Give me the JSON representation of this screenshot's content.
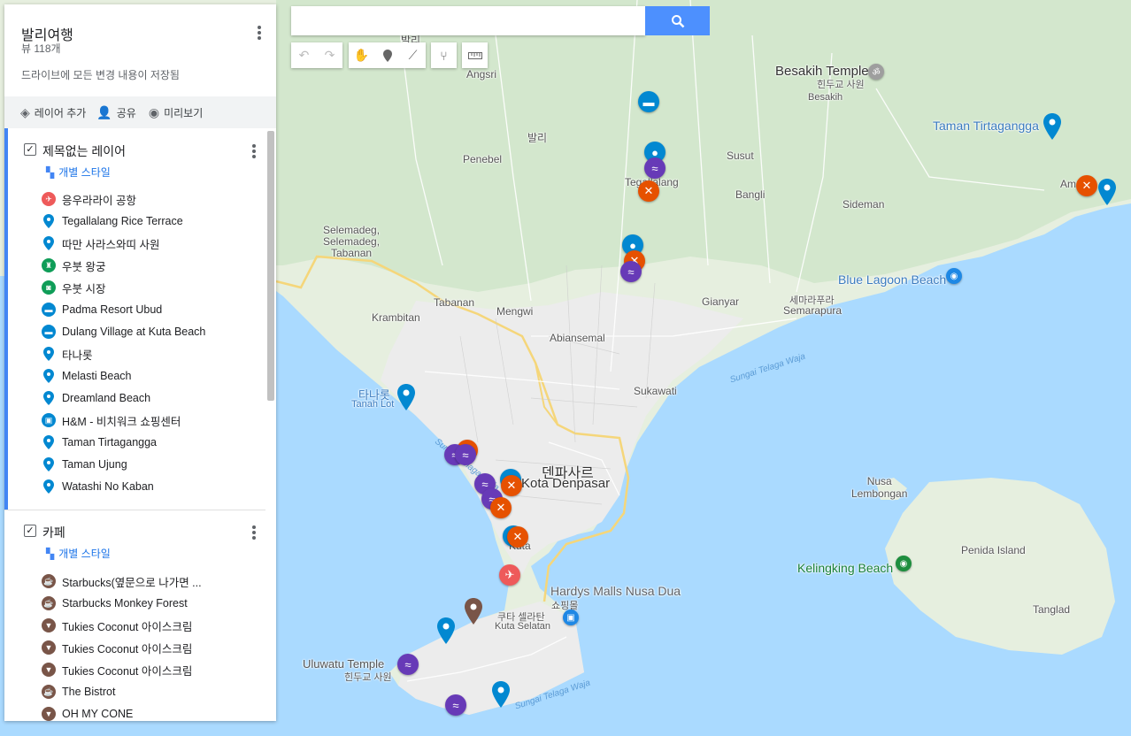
{
  "panel": {
    "title": "발리여행",
    "views": "뷰 118개",
    "saved_status": "드라이브에 모든 변경 내용이 저장됨",
    "actions": {
      "add_layer": "레이어 추가",
      "share": "공유",
      "preview": "미리보기"
    },
    "layers": [
      {
        "name": "제목없는 레이어",
        "style_link": "개별 스타일",
        "checked": true,
        "items": [
          {
            "label": "응우라라이 공항",
            "icon": "airport-icon",
            "color": "#ee5a5a"
          },
          {
            "label": "Tegallalang Rice Terrace",
            "icon": "pin-icon",
            "color": "#0288d1"
          },
          {
            "label": "따만 사라스와띠 사원",
            "icon": "pin-icon",
            "color": "#0288d1"
          },
          {
            "label": "우붓 왕궁",
            "icon": "castle-icon",
            "color": "#0f9d58"
          },
          {
            "label": "우붓 시장",
            "icon": "market-icon",
            "color": "#0f9d58"
          },
          {
            "label": "Padma Resort Ubud",
            "icon": "hotel-icon",
            "color": "#0288d1"
          },
          {
            "label": "Dulang Village at Kuta Beach",
            "icon": "hotel-icon",
            "color": "#0288d1"
          },
          {
            "label": "타나롯",
            "icon": "pin-icon",
            "color": "#0288d1"
          },
          {
            "label": "Melasti Beach",
            "icon": "pin-icon",
            "color": "#0288d1"
          },
          {
            "label": "Dreamland Beach",
            "icon": "pin-icon",
            "color": "#0288d1"
          },
          {
            "label": "H&M - 비치워크 쇼핑센터",
            "icon": "shopping-icon",
            "color": "#0288d1"
          },
          {
            "label": "Taman Tirtagangga",
            "icon": "pin-icon",
            "color": "#0288d1"
          },
          {
            "label": "Taman Ujung",
            "icon": "pin-icon",
            "color": "#0288d1"
          },
          {
            "label": "Watashi No Kaban",
            "icon": "pin-icon",
            "color": "#0288d1"
          }
        ]
      },
      {
        "name": "카페",
        "style_link": "개별 스타일",
        "checked": true,
        "items": [
          {
            "label": "Starbucks(옆문으로 나가면 ...",
            "icon": "coffee-icon",
            "color": "#795548"
          },
          {
            "label": "Starbucks Monkey Forest",
            "icon": "coffee-icon",
            "color": "#795548"
          },
          {
            "label": "Tukies Coconut 아이스크림",
            "icon": "icecream-icon",
            "color": "#795548"
          },
          {
            "label": "Tukies Coconut 아이스크림",
            "icon": "icecream-icon",
            "color": "#795548"
          },
          {
            "label": "Tukies Coconut 아이스크림",
            "icon": "icecream-icon",
            "color": "#795548"
          },
          {
            "label": "The Bistrot",
            "icon": "coffee-icon",
            "color": "#795548"
          },
          {
            "label": "OH MY CONE",
            "icon": "icecream-icon",
            "color": "#795548"
          }
        ]
      }
    ]
  },
  "search": {
    "placeholder": "",
    "button_icon": "search-icon"
  },
  "toolbar": [
    "undo-icon",
    "redo-icon",
    "hand-icon",
    "add-marker-icon",
    "draw-line-icon",
    "directions-icon",
    "measure-icon"
  ],
  "map_labels": {
    "angsri": "Angsri",
    "bali": "발리",
    "bali_top": "발리",
    "penebel": "Penebel",
    "susut": "Susut",
    "bangli": "Bangli",
    "besakih_temple": "Besakih Temple",
    "besakih_temple_ko": "힌두교 사원",
    "besakih": "Besakih",
    "taman_tirtagangga": "Taman Tirtagangga",
    "amlapura": "Am",
    "sideman": "Sideman",
    "selemadeg": "Selemadeg,\nSelemadeg,\nTabanan",
    "tegallalang": "Tegallalang",
    "blue_lagoon": "Blue Lagoon Beach",
    "tabanan": "Tabanan",
    "mengwi": "Mengwi",
    "krambitan": "Krambitan",
    "gianyar": "Gianyar",
    "semarapura_ko": "세마라푸라",
    "semarapura": "Semarapura",
    "abiansemal": "Abiansemal",
    "sungai1": "Sungai Telaga Waja",
    "tanah_lot_ko": "타나롯",
    "tanah_lot": "Tanah Lot",
    "sukawati": "Sukawati",
    "sungai2": "Sungai Telaga Waja",
    "denpasar_ko": "덴파사르",
    "denpasar": "Kota Denpasar",
    "nusa_lembongan": "Nusa\nLembongan",
    "penida": "Penida Island",
    "kelingking": "Kelingking Beach",
    "hardys": "Hardys Malls Nusa Dua",
    "hardys_ko": "쇼핑몰",
    "kuta_selatan_ko": "쿠타 셀라탄",
    "kuta_selatan": "Kuta Selatan",
    "tanglad": "Tanglad",
    "uluwatu": "Uluwatu Temple",
    "uluwatu_ko": "힌두교 사원",
    "sungai3": "Sungai Telaga Waja",
    "kuta": "Kuta"
  },
  "colors": {
    "water": "#aadaff",
    "land": "#e8efe0",
    "urban": "#eeeeee",
    "airport_red": "#ee5a5a",
    "pin_blue": "#0288d1",
    "swim_purple": "#673ab7",
    "food_orange": "#e65100",
    "cafe_brown": "#795548",
    "accent_blue": "#4d90fe"
  }
}
